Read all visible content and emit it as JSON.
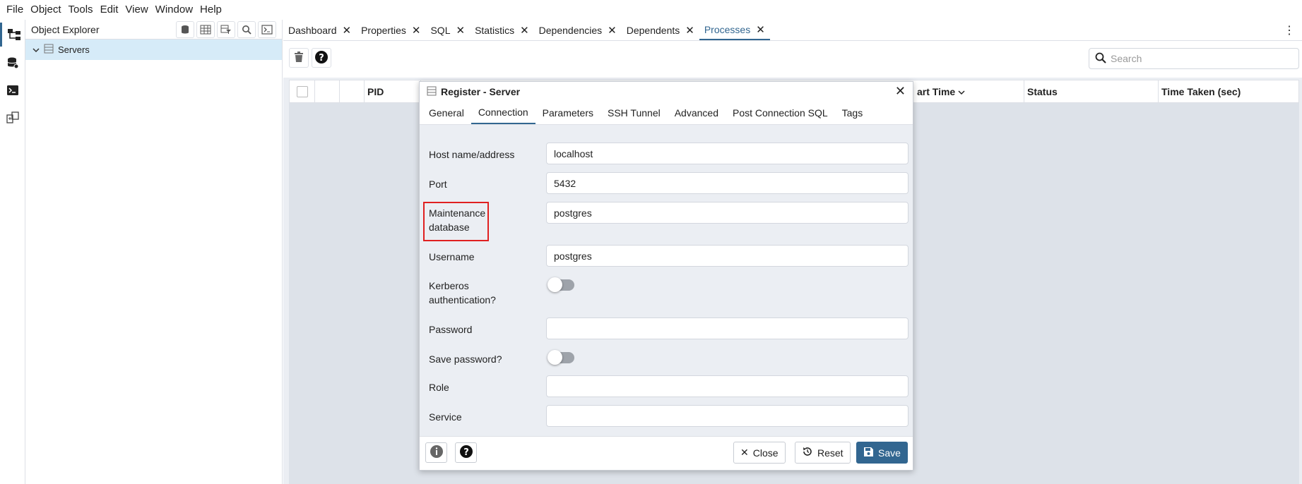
{
  "menubar": {
    "items": [
      "File",
      "Object",
      "Tools",
      "Edit",
      "View",
      "Window",
      "Help"
    ]
  },
  "rail": {
    "icons": [
      "object-explorer-icon",
      "database-icon",
      "terminal-icon",
      "schema-diff-icon"
    ]
  },
  "explorer": {
    "title": "Object Explorer",
    "tree": [
      {
        "label": "Servers",
        "expanded": true
      }
    ]
  },
  "tabs": [
    {
      "label": "Dashboard",
      "active": false
    },
    {
      "label": "Properties",
      "active": false
    },
    {
      "label": "SQL",
      "active": false
    },
    {
      "label": "Statistics",
      "active": false
    },
    {
      "label": "Dependencies",
      "active": false
    },
    {
      "label": "Dependents",
      "active": false
    },
    {
      "label": "Processes",
      "active": true
    }
  ],
  "search": {
    "placeholder": "Search",
    "value": ""
  },
  "grid": {
    "columns": [
      "PID",
      "art Time",
      "Status",
      "Time Taken (sec)"
    ]
  },
  "dialog": {
    "title": "Register - Server",
    "tabs": [
      "General",
      "Connection",
      "Parameters",
      "SSH Tunnel",
      "Advanced",
      "Post Connection SQL",
      "Tags"
    ],
    "active_tab": "Connection",
    "fields": {
      "host": {
        "label": "Host name/address",
        "value": "localhost"
      },
      "port": {
        "label": "Port",
        "value": "5432"
      },
      "maintenance_db": {
        "label_line1": "Maintenance",
        "label_line2": "database",
        "value": "postgres"
      },
      "username": {
        "label": "Username",
        "value": "postgres"
      },
      "kerberos": {
        "label_line1": "Kerberos",
        "label_line2": "authentication?",
        "on": false
      },
      "password": {
        "label": "Password",
        "value": ""
      },
      "save_password": {
        "label": "Save password?",
        "on": false
      },
      "role": {
        "label": "Role",
        "value": ""
      },
      "service": {
        "label": "Service",
        "value": ""
      }
    },
    "footer": {
      "close_label": "Close",
      "reset_label": "Reset",
      "save_label": "Save"
    }
  },
  "colors": {
    "accent": "#326690",
    "highlight_box": "#e02020",
    "selection": "#d6ebf8"
  }
}
